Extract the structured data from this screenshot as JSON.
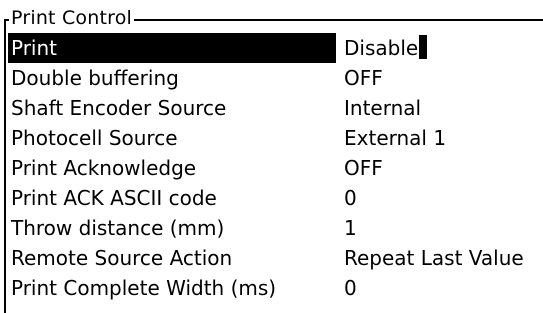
{
  "group": {
    "title": "Print Control"
  },
  "rows": [
    {
      "label": "Print",
      "value": "Disable"
    },
    {
      "label": "Double buffering",
      "value": "OFF"
    },
    {
      "label": "Shaft Encoder Source",
      "value": "Internal"
    },
    {
      "label": "Photocell Source",
      "value": "External 1"
    },
    {
      "label": "Print Acknowledge",
      "value": "OFF"
    },
    {
      "label": "Print ACK ASCII code",
      "value": "0"
    },
    {
      "label": "Throw distance (mm)",
      "value": "1"
    },
    {
      "label": "Remote Source Action",
      "value": "Repeat Last Value"
    },
    {
      "label": "Print Complete Width (ms)",
      "value": "0"
    }
  ]
}
